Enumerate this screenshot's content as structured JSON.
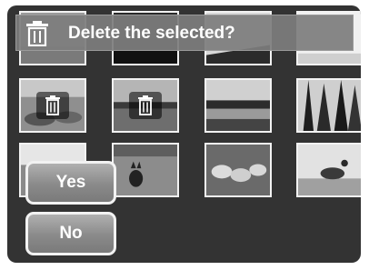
{
  "dialog": {
    "prompt": "Delete the selected?",
    "icon": "trash-icon",
    "yes_label": "Yes",
    "no_label": "No"
  },
  "thumbnails": [
    {
      "row": 1,
      "col": 1,
      "subject": "landscape",
      "selected": false
    },
    {
      "row": 1,
      "col": 2,
      "subject": "dark scene",
      "selected": false
    },
    {
      "row": 1,
      "col": 3,
      "subject": "shoreline",
      "selected": false
    },
    {
      "row": 1,
      "col": 4,
      "subject": "bright sky",
      "selected": false
    },
    {
      "row": 2,
      "col": 1,
      "subject": "pond",
      "selected": true
    },
    {
      "row": 2,
      "col": 2,
      "subject": "lake",
      "selected": true
    },
    {
      "row": 2,
      "col": 3,
      "subject": "lakeside",
      "selected": false
    },
    {
      "row": 2,
      "col": 4,
      "subject": "forest",
      "selected": false
    },
    {
      "row": 3,
      "col": 1,
      "subject": "field",
      "selected": false
    },
    {
      "row": 3,
      "col": 2,
      "subject": "fox",
      "selected": false
    },
    {
      "row": 3,
      "col": 3,
      "subject": "sheep",
      "selected": false
    },
    {
      "row": 3,
      "col": 4,
      "subject": "bird",
      "selected": false
    }
  ],
  "colors": {
    "background": "#333333",
    "banner": "#7d7d7d",
    "button_border": "#f2f2f2",
    "text": "#ffffff"
  }
}
